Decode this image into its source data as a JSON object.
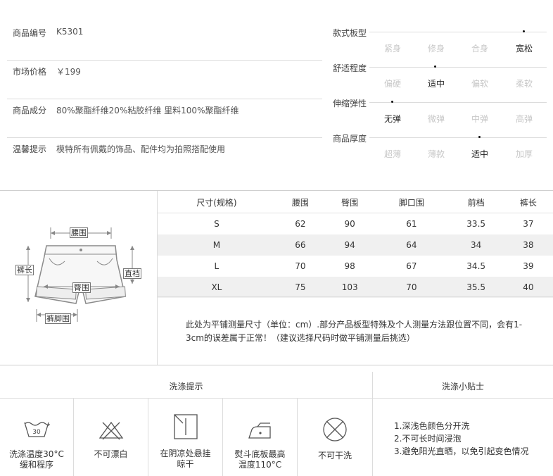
{
  "info": [
    {
      "label": "商品编号",
      "value": "K5301"
    },
    {
      "label": "市场价格",
      "value": "￥199"
    },
    {
      "label": "商品成分",
      "value": "80%聚酯纤维20%粘胶纤维 里料100%聚酯纤维"
    },
    {
      "label": "温馨提示",
      "value": "模特所有佩戴的饰品、配件均为拍照搭配使用"
    }
  ],
  "scales": [
    {
      "title": "款式板型",
      "options": [
        "紧身",
        "修身",
        "合身",
        "宽松"
      ],
      "selected": 3
    },
    {
      "title": "舒适程度",
      "options": [
        "偏硬",
        "适中",
        "偏软",
        "柔软"
      ],
      "selected": 1
    },
    {
      "title": "伸缩弹性",
      "options": [
        "无弹",
        "微弹",
        "中弹",
        "高弹"
      ],
      "selected": 0
    },
    {
      "title": "商品厚度",
      "options": [
        "超薄",
        "薄款",
        "适中",
        "加厚"
      ],
      "selected": 2
    }
  ],
  "diagram": {
    "waist": "腰围",
    "length": "裤长",
    "rise": "直裆",
    "hip": "臀围",
    "hem": "裤脚围"
  },
  "size_table": {
    "headers": [
      "尺寸(规格)",
      "腰围",
      "臀围",
      "脚口围",
      "前档",
      "裤长"
    ],
    "rows": [
      [
        "S",
        "62",
        "90",
        "61",
        "33.5",
        "37"
      ],
      [
        "M",
        "66",
        "94",
        "64",
        "34",
        "38"
      ],
      [
        "L",
        "70",
        "98",
        "67",
        "34.5",
        "39"
      ],
      [
        "XL",
        "75",
        "103",
        "70",
        "35.5",
        "40"
      ]
    ]
  },
  "size_note": {
    "line1": "此处为平铺测量尺寸（单位：cm）.部分产品板型特殊及个人测量方法跟位置不同，会有1-",
    "line2": "3cm的误差属于正常！（建议选择尺码时做平铺测量后挑选）"
  },
  "care": {
    "title": "洗涤提示",
    "items": [
      {
        "icon": "wash-30-icon",
        "line1": "洗涤温度30°C",
        "line2": "缓和程序",
        "badge": "30"
      },
      {
        "icon": "no-bleach-icon",
        "line1": "不可漂白",
        "line2": ""
      },
      {
        "icon": "line-dry-shade-icon",
        "line1": "在阴凉处悬挂",
        "line2": "晾干"
      },
      {
        "icon": "iron-110-icon",
        "line1": "熨斗底板最高",
        "line2": "温度110°C"
      },
      {
        "icon": "no-dry-clean-icon",
        "line1": "不可干洗",
        "line2": ""
      }
    ]
  },
  "tips": {
    "title": "洗涤小贴士",
    "items": [
      "1.深浅色颜色分开洗",
      "2.不可长时间浸泡",
      "3.避免阳光直晒，以免引起变色情况"
    ]
  }
}
